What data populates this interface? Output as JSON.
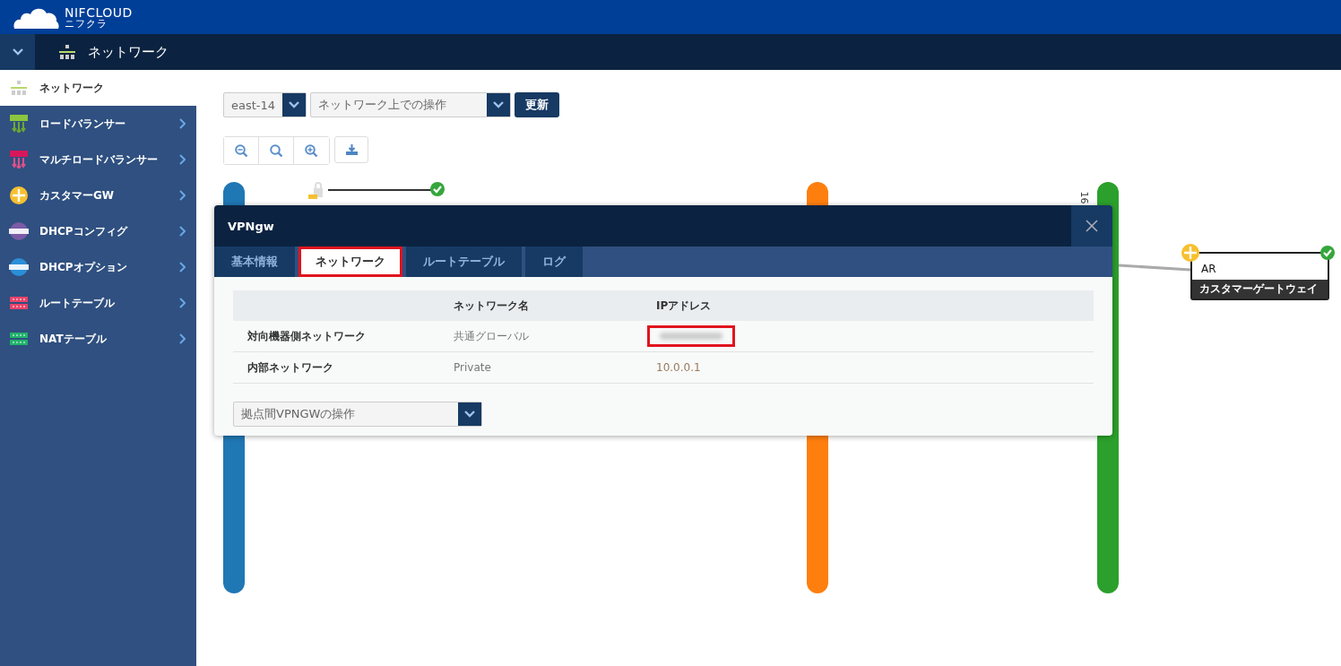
{
  "header": {
    "logo": "NIFCLOUD",
    "logo_sub": "ニフクラ"
  },
  "nav": {
    "title": "ネットワーク"
  },
  "sidebar": {
    "items": [
      {
        "label": "ネットワーク",
        "selected": true,
        "kind": "network"
      },
      {
        "label": "ロードバランサー",
        "selected": false,
        "kind": "lb"
      },
      {
        "label": "マルチロードバランサー",
        "selected": false,
        "kind": "mlb"
      },
      {
        "label": "カスタマーGW",
        "selected": false,
        "kind": "cgw"
      },
      {
        "label": "DHCPコンフィグ",
        "selected": false,
        "kind": "dhcp_config"
      },
      {
        "label": "DHCPオプション",
        "selected": false,
        "kind": "dhcp_option"
      },
      {
        "label": "ルートテーブル",
        "selected": false,
        "kind": "route"
      },
      {
        "label": "NATテーブル",
        "selected": false,
        "kind": "nat"
      }
    ]
  },
  "toolbar": {
    "zone": "east-14",
    "operation_placeholder": "ネットワーク上での操作",
    "refresh": "更新"
  },
  "diagram": {
    "networks": [
      {
        "color": "#1f77b4"
      },
      {
        "color": "#ff7f0e"
      },
      {
        "color": "#2ca02c",
        "label": "16"
      }
    ],
    "node": {
      "name": "AR",
      "type": "カスタマーゲートウェイ"
    }
  },
  "popup": {
    "title": "VPNgw",
    "tabs": [
      {
        "label": "基本情報",
        "selected": false,
        "highlighted": false
      },
      {
        "label": "ネットワーク",
        "selected": true,
        "highlighted": true
      },
      {
        "label": "ルートテーブル",
        "selected": false,
        "highlighted": false
      },
      {
        "label": "ログ",
        "selected": false,
        "highlighted": false
      }
    ],
    "columns": [
      "ネットワーク名",
      "IPアドレス"
    ],
    "rows": [
      {
        "name": "対向機器側ネットワーク",
        "network": "共通グローバル",
        "ip_blurred": true,
        "highlighted": true
      },
      {
        "name": "内部ネットワーク",
        "network": "Private",
        "ip": "10.0.0.1"
      }
    ],
    "action_placeholder": "拠点間VPNGWの操作"
  }
}
